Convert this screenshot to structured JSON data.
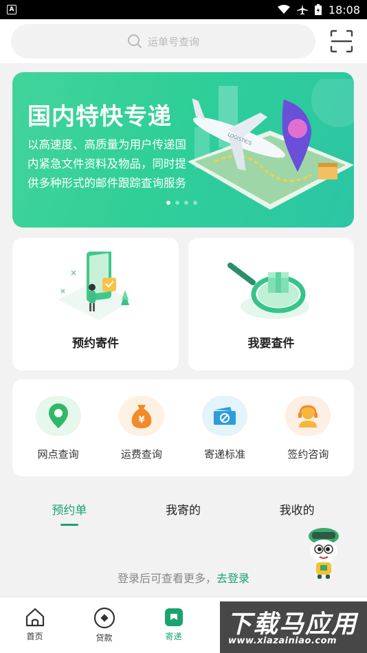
{
  "status_bar": {
    "left_badge": "A",
    "time": "18:08"
  },
  "search": {
    "placeholder": "运单号查询"
  },
  "banner": {
    "title": "国内特快专递",
    "description": "以高速度、高质量为用户传递国内紧急文件资料及物品，同时提供多种形式的邮件跟踪查询服务",
    "art_text": "LOGISTICS",
    "page_count": 4,
    "active_page": 1
  },
  "cards": {
    "left_label": "预约寄件",
    "right_label": "我要查件"
  },
  "services": [
    {
      "label": "网点查询",
      "icon": "location-pin-icon",
      "color": "#2fb86a"
    },
    {
      "label": "运费查询",
      "icon": "money-bag-icon",
      "color": "#f08a2a"
    },
    {
      "label": "寄递标准",
      "icon": "package-standard-icon",
      "color": "#2e9cdb"
    },
    {
      "label": "签约咨询",
      "icon": "customer-service-icon",
      "color": "#f0a030"
    }
  ],
  "tabs": [
    {
      "label": "预约单",
      "active": true
    },
    {
      "label": "我寄的",
      "active": false
    },
    {
      "label": "我收的",
      "active": false
    }
  ],
  "login_hint": {
    "text": "登录后可查看更多，",
    "link": "去登录"
  },
  "bottom_nav": [
    {
      "label": "首页",
      "icon": "home-icon",
      "active": false
    },
    {
      "label": "贷款",
      "icon": "loan-icon",
      "active": false
    },
    {
      "label": "寄递",
      "icon": "mail-delivery-icon",
      "active": true
    }
  ],
  "watermark": {
    "title": "下载马应用",
    "url": "www.xiazainiao.com"
  },
  "colors": {
    "accent": "#1aa36f",
    "banner_start": "#42d49a",
    "banner_end": "#2cc6a4"
  }
}
